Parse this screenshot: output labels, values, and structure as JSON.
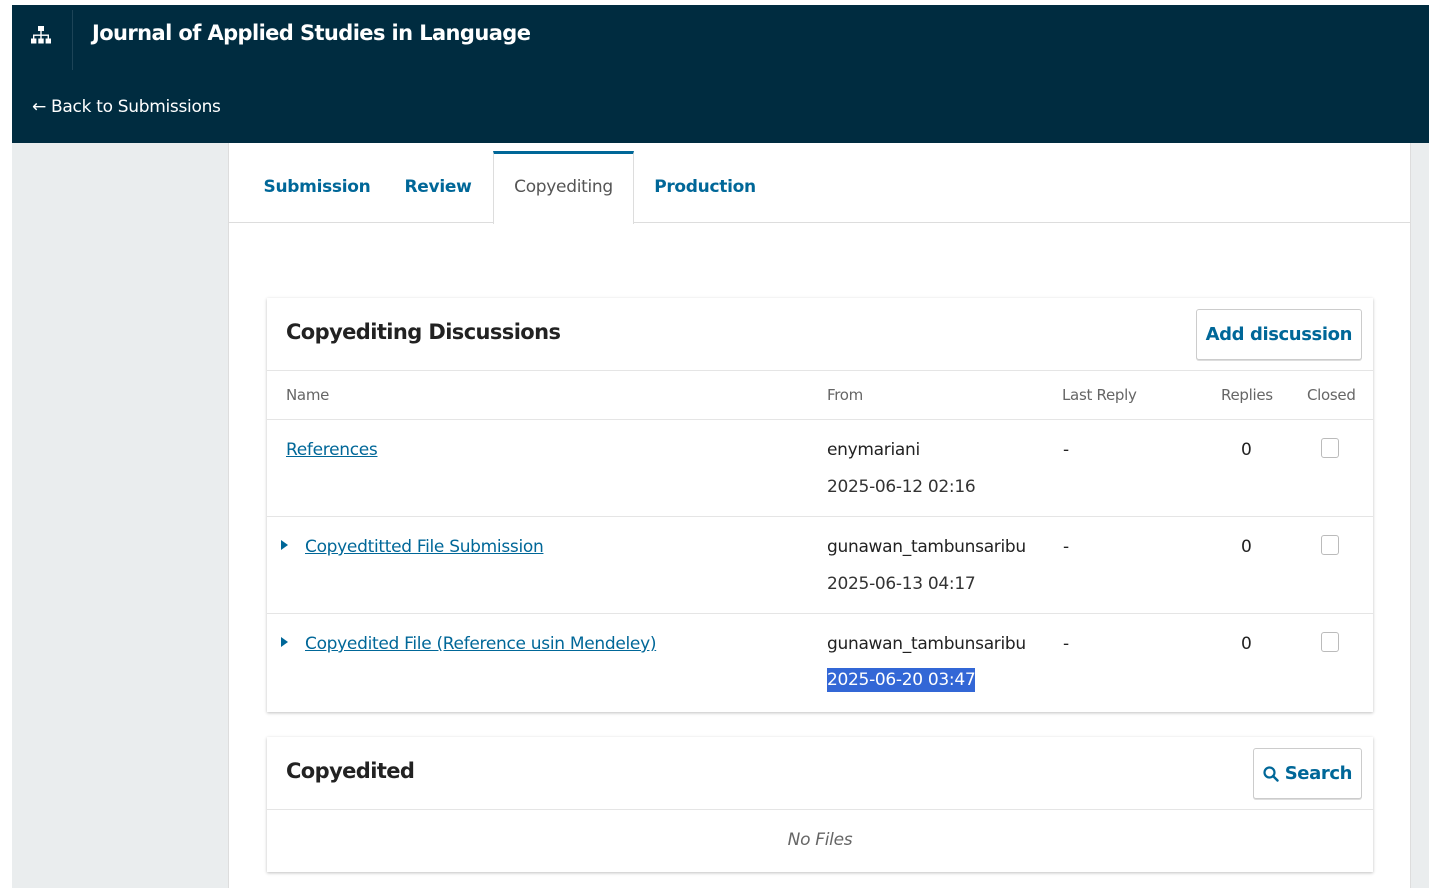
{
  "header": {
    "journal_title": "Journal of Applied Studies in Language",
    "back_link": "← Back to Submissions",
    "brand_icon": "sitemap-icon"
  },
  "tabs": [
    {
      "label": "Submission",
      "active": false
    },
    {
      "label": "Review",
      "active": false
    },
    {
      "label": "Copyediting",
      "active": true
    },
    {
      "label": "Production",
      "active": false
    }
  ],
  "discussions": {
    "title": "Copyediting Discussions",
    "add_button": "Add discussion",
    "columns": {
      "name": "Name",
      "from": "From",
      "last_reply": "Last Reply",
      "replies": "Replies",
      "closed": "Closed"
    },
    "rows": [
      {
        "name": "References",
        "from_user": "enymariani",
        "from_date": "2025-06-12 02:16",
        "last_reply": "-",
        "replies": "0",
        "closed": false,
        "expandable": false
      },
      {
        "name": "Copyedtitted File Submission",
        "from_user": "gunawan_tambunsaribu",
        "from_date": "2025-06-13 04:17",
        "last_reply": "-",
        "replies": "0",
        "closed": false,
        "expandable": true
      },
      {
        "name": "Copyedited File (Reference usin Mendeley)",
        "from_user": "gunawan_tambunsaribu",
        "from_date": "2025-06-20 03:47",
        "last_reply": "-",
        "replies": "0",
        "closed": false,
        "expandable": true,
        "date_selected": true
      }
    ]
  },
  "copyedited": {
    "title": "Copyedited",
    "search_button": "Search",
    "search_icon": "magnifier-icon",
    "empty_text": "No Files"
  },
  "colors": {
    "header_bg": "#002c40",
    "accent": "#006798",
    "selection": "#3367d6",
    "page_bg": "#eaedee"
  }
}
